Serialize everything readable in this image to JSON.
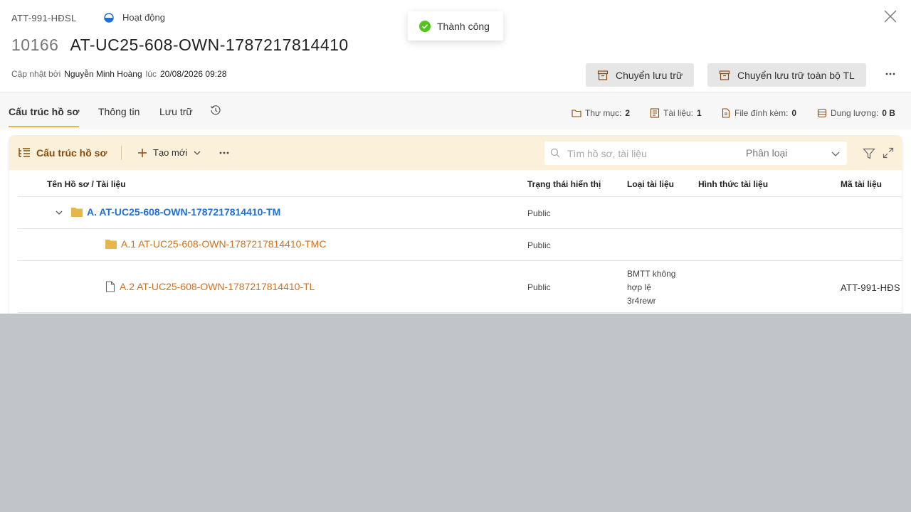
{
  "header": {
    "record_code": "ATT-991-HĐSL",
    "status_label": "Hoạt động",
    "record_id": "10166",
    "record_title": "AT-UC25-608-OWN-1787217814410",
    "updated_by_label": "Cập nhật bởi",
    "updated_by": "Nguyễn Minh Hoàng",
    "at_label": "lúc",
    "updated_at": "20/08/2026 09:28",
    "archive_button": "Chuyển lưu trữ",
    "archive_all_button": "Chuyển lưu trữ toàn bộ TL"
  },
  "toast": {
    "message": "Thành công"
  },
  "tabs": [
    {
      "label": "Cấu trúc hồ sơ",
      "active": true
    },
    {
      "label": "Thông tin",
      "active": false
    },
    {
      "label": "Lưu trữ",
      "active": false
    }
  ],
  "stats": {
    "folders_label": "Thư mục:",
    "folders_value": "2",
    "docs_label": "Tài liệu:",
    "docs_value": "1",
    "attachments_label": "File đính kèm:",
    "attachments_value": "0",
    "size_label": "Dung lượng:",
    "size_value": "0 B"
  },
  "toolbar": {
    "title": "Cấu trúc hồ sơ",
    "create_label": "Tạo mới",
    "search_placeholder": "Tìm hồ sơ, tài liệu",
    "classify_label": "Phân loại"
  },
  "table": {
    "columns": [
      "Tên Hồ sơ / Tài liệu",
      "Trạng thái hiển thị",
      "Loại tài liệu",
      "Hình thức tài liệu",
      "Mã tài liệu"
    ],
    "rows": [
      {
        "name": "A. AT-UC25-608-OWN-1787217814410-TM",
        "status": "Public",
        "type": "",
        "form": "",
        "code": ""
      },
      {
        "name": "A.1 AT-UC25-608-OWN-1787217814410-TMC",
        "status": "Public",
        "type": "",
        "form": "",
        "code": ""
      },
      {
        "name": "A.2 AT-UC25-608-OWN-1787217814410-TL",
        "status": "Public",
        "type_lines": [
          "BMTT không",
          "hợp lệ",
          "3r4rewr"
        ],
        "form": "",
        "code": "ATT-991-HĐS"
      }
    ]
  },
  "colors": {
    "accent": "#e6b64b",
    "toolbar_bg": "#fbf0da",
    "link_blue": "#1e6fd9",
    "link_orange": "#d0701d",
    "success": "#52c41a",
    "overlay": "#c1c4c9"
  }
}
